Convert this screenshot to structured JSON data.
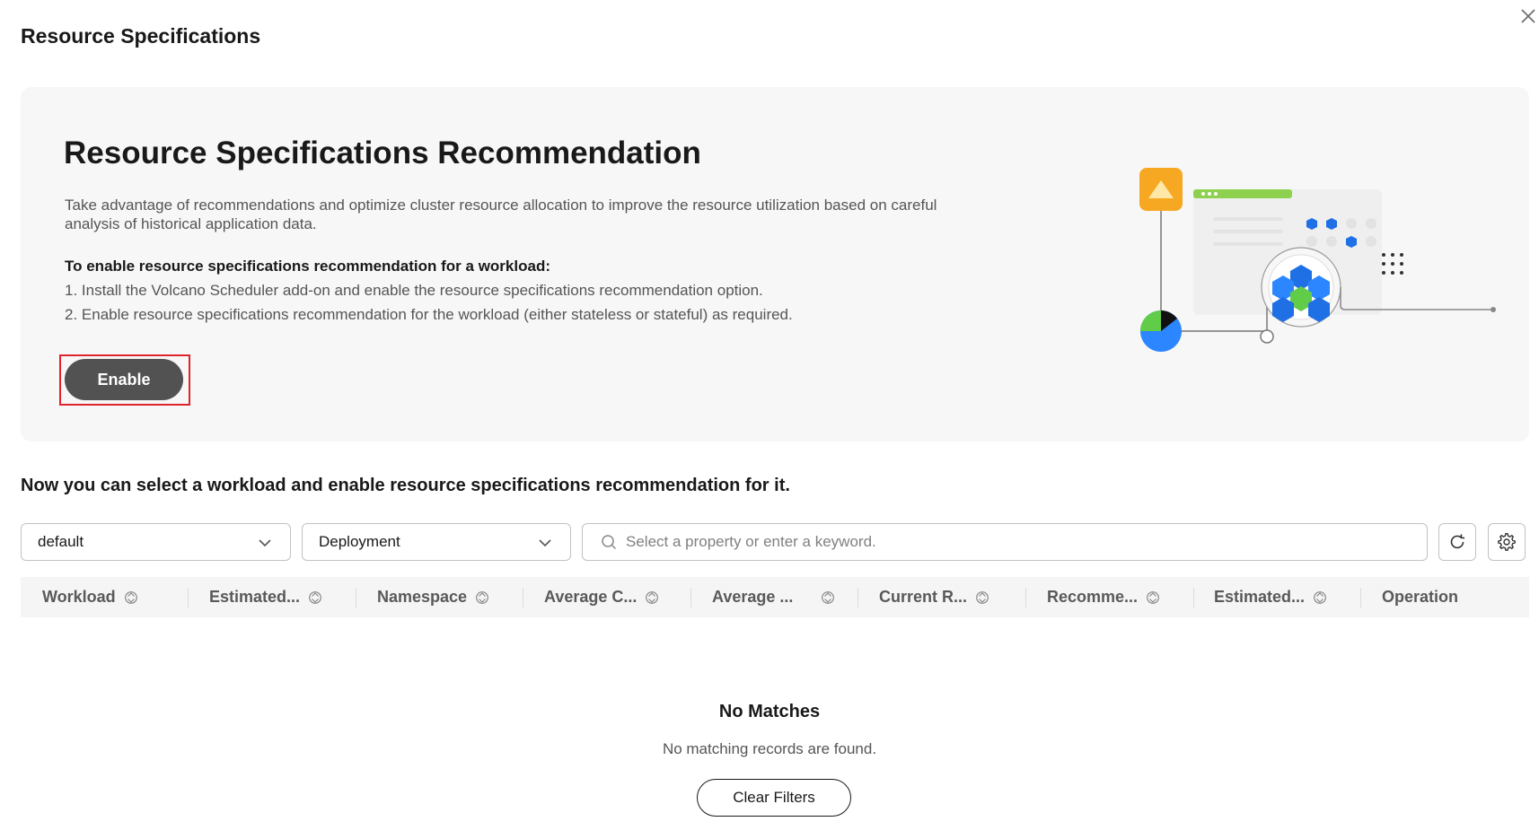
{
  "dialog": {
    "title": "Resource Specifications",
    "close_icon": "close-icon"
  },
  "banner": {
    "title": "Resource Specifications Recommendation",
    "description": "Take advantage of recommendations and optimize cluster resource allocation to improve the resource utilization based on careful analysis of historical application data.",
    "steps_title": "To enable resource specifications recommendation for a workload:",
    "steps": [
      "1. Install the Volcano Scheduler add-on and enable the resource specifications recommendation option.",
      "2. Enable resource specifications recommendation for the workload (either stateless or stateful) as required."
    ],
    "enable_label": "Enable",
    "highlight_color": "#e0242b",
    "illustration": "resource-recommendation-illustration"
  },
  "section": {
    "text": "Now you can select a workload and enable resource specifications recommendation for it."
  },
  "filters": {
    "namespace_value": "default",
    "type_value": "Deployment",
    "search_placeholder": "Select a property or enter a keyword.",
    "refresh_icon": "refresh-icon",
    "settings_icon": "gear-icon"
  },
  "table": {
    "columns": [
      "Workload",
      "Estimated...",
      "Namespace",
      "Average C...",
      "Average ...",
      "Current R...",
      "Recomme...",
      "Estimated...",
      "Operation"
    ]
  },
  "empty": {
    "title": "No Matches",
    "description": "No matching records are found.",
    "clear_label": "Clear Filters"
  }
}
